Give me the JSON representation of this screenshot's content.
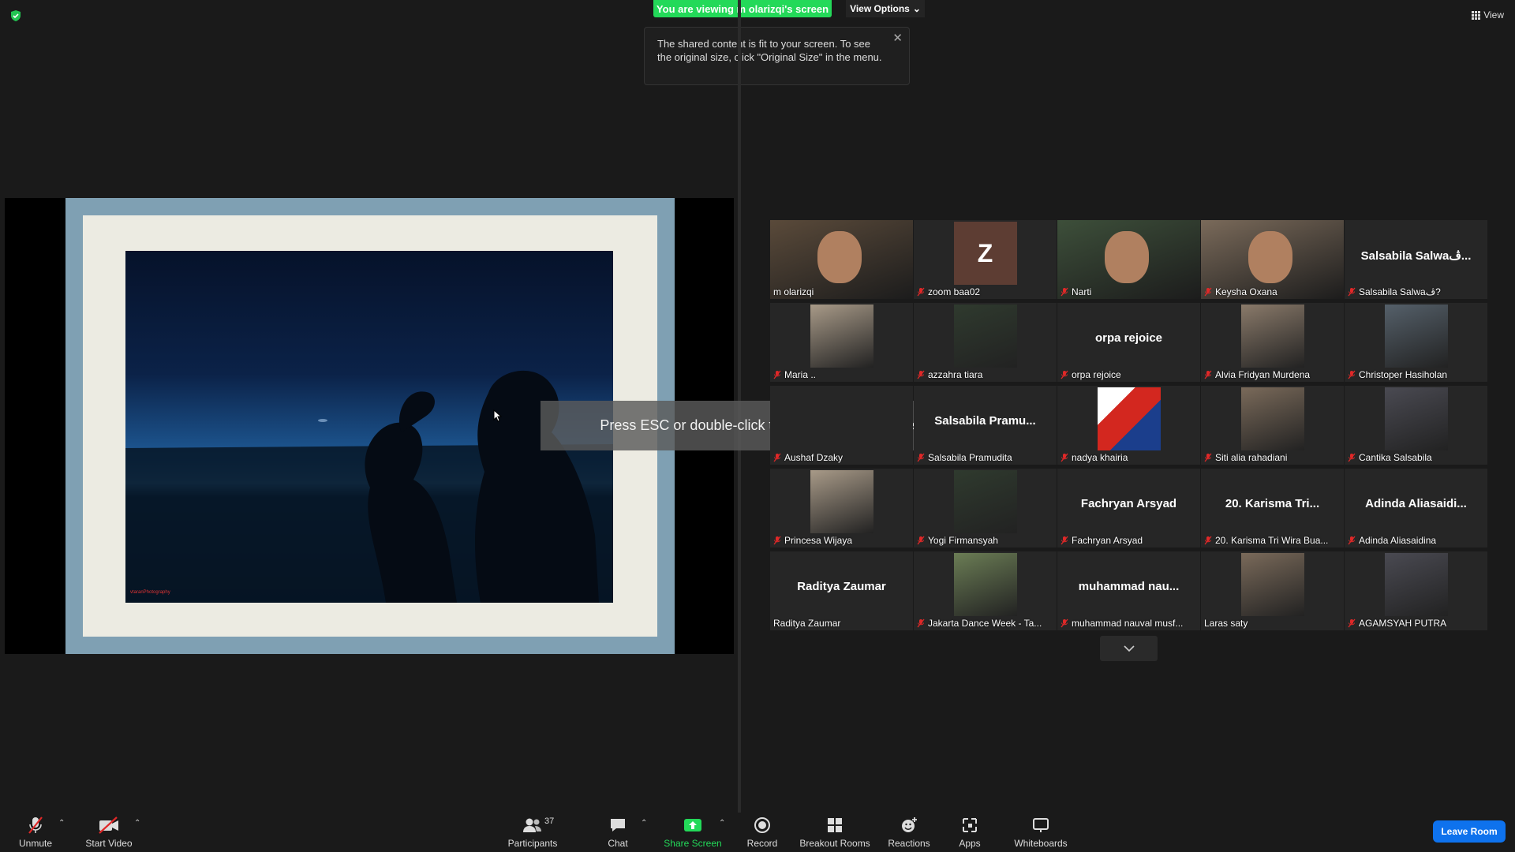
{
  "banner": {
    "viewing": "You are viewing m olarizqi's screen",
    "view_options": "View Options",
    "view": "View"
  },
  "tooltip": {
    "text": "The shared content is fit to your screen. To see the original size, click \"Original Size\" in the menu."
  },
  "share": {
    "watermark": "vtaranPhotography"
  },
  "esc_hint": "Press ESC or double-click to exit full screen mode",
  "participants": [
    {
      "name": "m olarizqi",
      "big": "",
      "avatar": "video",
      "active": true,
      "muted": false
    },
    {
      "name": "zoom baa02",
      "big": "",
      "avatar": "Z",
      "active": false,
      "muted": true
    },
    {
      "name": "Narti",
      "big": "",
      "avatar": "video",
      "active": false,
      "muted": true
    },
    {
      "name": "Keysha Oxana",
      "big": "",
      "avatar": "video",
      "active": false,
      "muted": true
    },
    {
      "name": "Salsabila Salwaڤ?",
      "big": "Salsabila  Salwaڤ...",
      "avatar": "",
      "active": false,
      "muted": true
    },
    {
      "name": "Maria ..",
      "big": "",
      "avatar": "photo",
      "active": false,
      "muted": true
    },
    {
      "name": "azzahra tiara",
      "big": "",
      "avatar": "photo",
      "active": false,
      "muted": true
    },
    {
      "name": "orpa rejoice",
      "big": "orpa rejoice",
      "avatar": "",
      "active": false,
      "muted": true
    },
    {
      "name": "Alvia Fridyan Murdena",
      "big": "",
      "avatar": "photo",
      "active": false,
      "muted": true
    },
    {
      "name": "Christoper Hasiholan",
      "big": "",
      "avatar": "photo",
      "active": false,
      "muted": true
    },
    {
      "name": "Aushaf Dzaky",
      "big": "",
      "avatar": "",
      "active": false,
      "muted": true
    },
    {
      "name": "Salsabila Pramudita",
      "big": "Salsabila  Pramu...",
      "avatar": "",
      "active": false,
      "muted": true
    },
    {
      "name": "nadya khairia",
      "big": "",
      "avatar": "logo",
      "active": false,
      "muted": true
    },
    {
      "name": "Siti alia rahadiani",
      "big": "",
      "avatar": "photo",
      "active": false,
      "muted": true
    },
    {
      "name": "Cantika Salsabila",
      "big": "",
      "avatar": "photo",
      "active": false,
      "muted": true
    },
    {
      "name": "Princesa Wijaya",
      "big": "",
      "avatar": "photo",
      "active": false,
      "muted": true
    },
    {
      "name": "Yogi Firmansyah",
      "big": "",
      "avatar": "photo",
      "active": false,
      "muted": true
    },
    {
      "name": "Fachryan Arsyad",
      "big": "Fachryan Arsyad",
      "avatar": "",
      "active": false,
      "muted": true
    },
    {
      "name": "20. Karisma Tri Wira Bua...",
      "big": "20. Karisma Tri...",
      "avatar": "",
      "active": false,
      "muted": true
    },
    {
      "name": "Adinda Aliasaidina",
      "big": "Adinda  Aliasaidi...",
      "avatar": "",
      "active": false,
      "muted": true
    },
    {
      "name": "Raditya Zaumar",
      "big": "Raditya Zaumar",
      "avatar": "",
      "active": false,
      "muted": false
    },
    {
      "name": "Jakarta Dance Week - Ta...",
      "big": "",
      "avatar": "photo",
      "active": false,
      "muted": true
    },
    {
      "name": "muhammad nauval musf...",
      "big": "muhammad  nau...",
      "avatar": "",
      "active": false,
      "muted": true
    },
    {
      "name": "Laras saty",
      "big": "",
      "avatar": "photo",
      "active": false,
      "muted": false
    },
    {
      "name": "AGAMSYAH PUTRA",
      "big": "",
      "avatar": "photo",
      "active": false,
      "muted": true
    }
  ],
  "toolbar": {
    "unmute": "Unmute",
    "start_video": "Start Video",
    "participants": "Participants",
    "participants_count": "37",
    "chat": "Chat",
    "share_screen": "Share Screen",
    "record": "Record",
    "breakout": "Breakout Rooms",
    "reactions": "Reactions",
    "apps": "Apps",
    "whiteboards": "Whiteboards",
    "leave": "Leave Room"
  },
  "colors": {
    "banner": "#23d959",
    "leave": "#0e72ed",
    "active_border": "#e8e37a",
    "mute": "#e02828"
  }
}
